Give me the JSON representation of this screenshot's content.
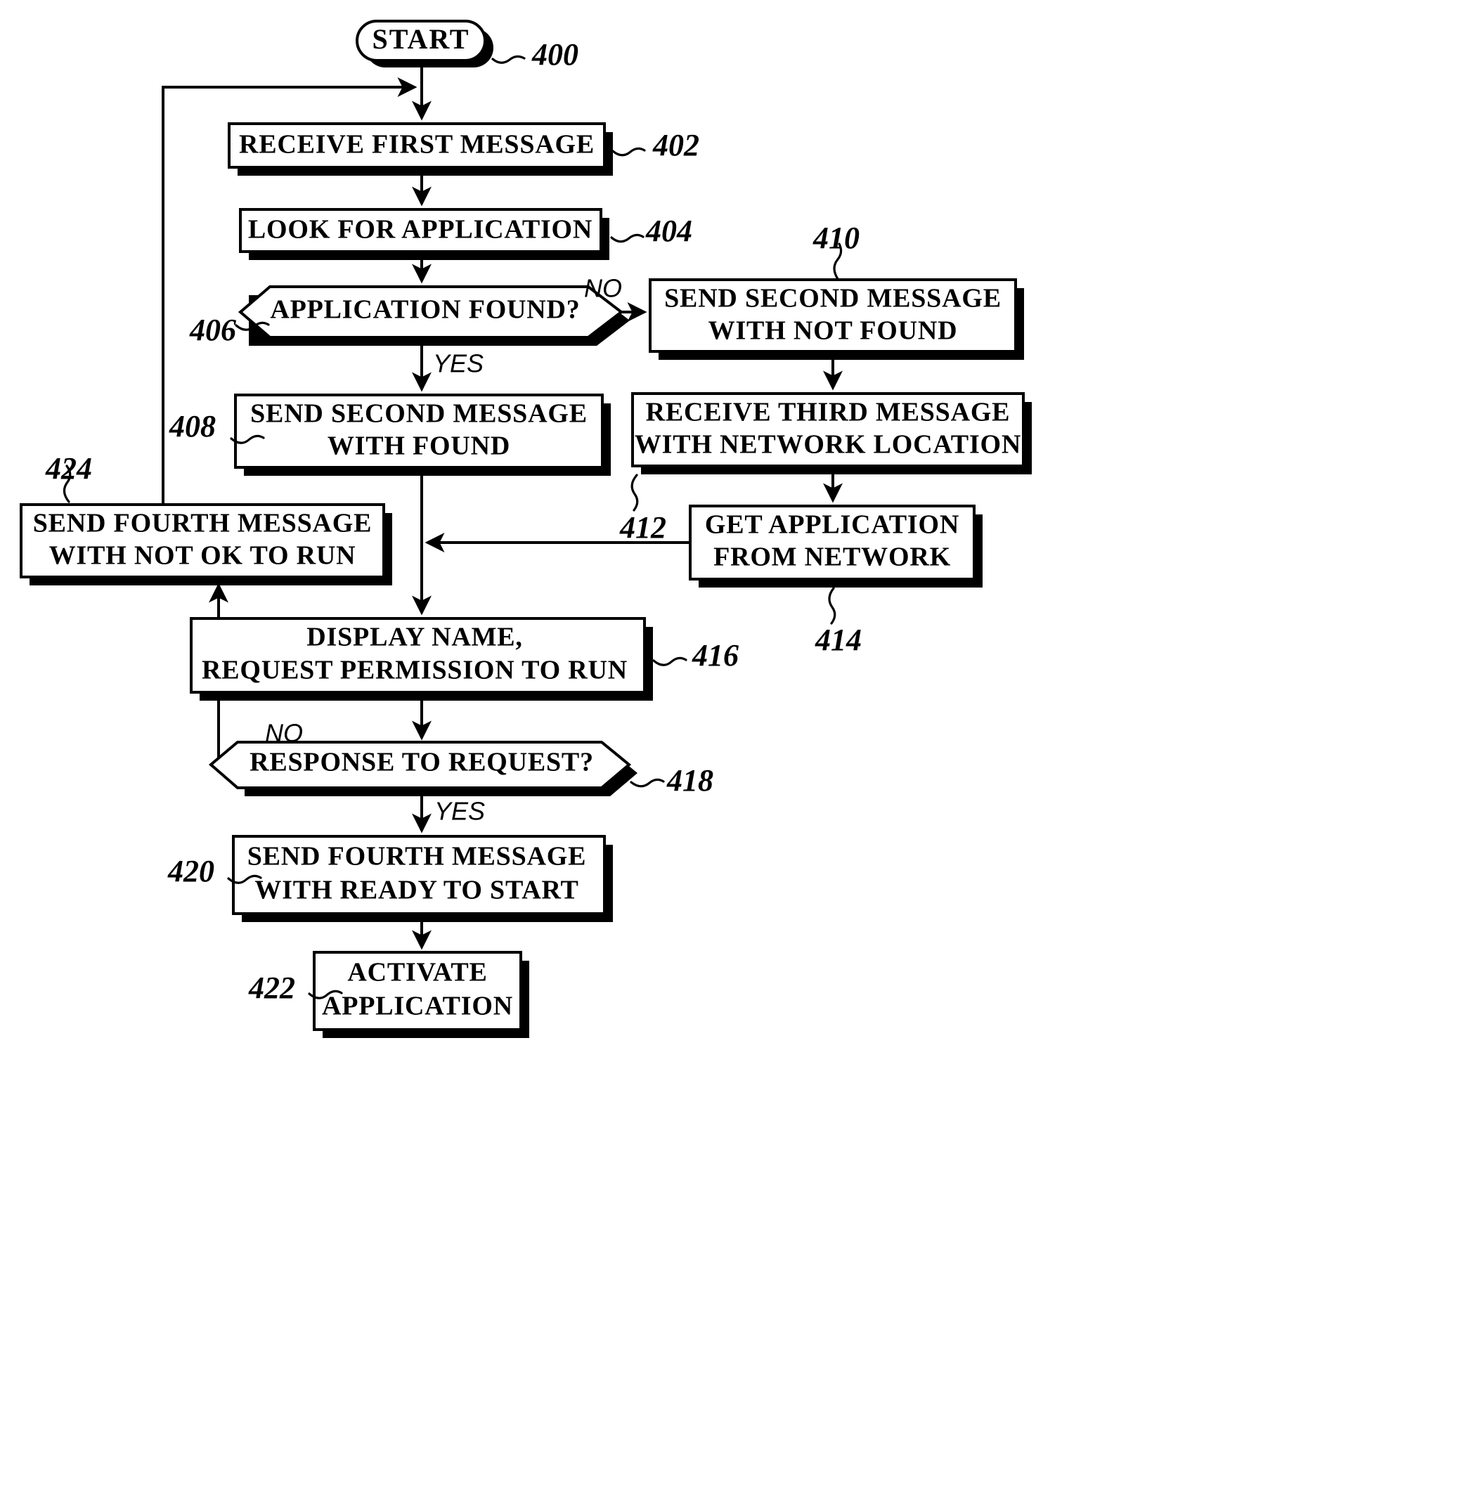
{
  "figure": {
    "type": "flowchart",
    "background": "#ffffff",
    "ink": "#000000"
  },
  "nodes": [
    {
      "id": "start",
      "ref": "400",
      "shape": "terminator",
      "lines": [
        "START"
      ]
    },
    {
      "id": "n402",
      "ref": "402",
      "shape": "process",
      "lines": [
        "RECEIVE FIRST MESSAGE"
      ]
    },
    {
      "id": "n404",
      "ref": "404",
      "shape": "process",
      "lines": [
        "LOOK FOR APPLICATION"
      ]
    },
    {
      "id": "n406",
      "ref": "406",
      "shape": "decision",
      "lines": [
        "APPLICATION FOUND?"
      ]
    },
    {
      "id": "n410",
      "ref": "410",
      "shape": "process",
      "lines": [
        "SEND SECOND MESSAGE",
        "WITH NOT FOUND"
      ]
    },
    {
      "id": "n408",
      "ref": "408",
      "shape": "process",
      "lines": [
        "SEND SECOND MESSAGE",
        "WITH FOUND"
      ]
    },
    {
      "id": "n412",
      "ref": "412",
      "shape": "process",
      "lines": [
        "RECEIVE THIRD MESSAGE",
        "WITH NETWORK LOCATION"
      ]
    },
    {
      "id": "n414",
      "ref": "414",
      "shape": "process",
      "lines": [
        "GET APPLICATION",
        "FROM NETWORK"
      ]
    },
    {
      "id": "n424",
      "ref": "424",
      "shape": "process",
      "lines": [
        "SEND FOURTH MESSAGE",
        "WITH NOT OK TO RUN"
      ]
    },
    {
      "id": "n416",
      "ref": "416",
      "shape": "process",
      "lines": [
        "DISPLAY NAME,",
        "REQUEST PERMISSION TO RUN"
      ]
    },
    {
      "id": "n418",
      "ref": "418",
      "shape": "decision",
      "lines": [
        "RESPONSE TO REQUEST?"
      ]
    },
    {
      "id": "n420",
      "ref": "420",
      "shape": "process",
      "lines": [
        "SEND FOURTH MESSAGE",
        "WITH READY TO START"
      ]
    },
    {
      "id": "n422",
      "ref": "422",
      "shape": "process",
      "lines": [
        "ACTIVATE",
        "APPLICATION"
      ]
    }
  ],
  "branch_labels": [
    {
      "id": "b406no",
      "text": "NO",
      "from": "n406"
    },
    {
      "id": "b406yes",
      "text": "YES",
      "from": "n406"
    },
    {
      "id": "b418no",
      "text": "NO",
      "from": "n418"
    },
    {
      "id": "b418yes",
      "text": "YES",
      "from": "n418"
    }
  ],
  "edges": [
    {
      "from": "start",
      "to": "n402"
    },
    {
      "from": "n402",
      "to": "n404"
    },
    {
      "from": "n404",
      "to": "n406"
    },
    {
      "from": "n406",
      "to": "n410",
      "label": "NO"
    },
    {
      "from": "n406",
      "to": "n408",
      "label": "YES"
    },
    {
      "from": "n410",
      "to": "n412"
    },
    {
      "from": "n412",
      "to": "n414"
    },
    {
      "from": "n414",
      "to": "n416"
    },
    {
      "from": "n408",
      "to": "n416"
    },
    {
      "from": "n416",
      "to": "n418"
    },
    {
      "from": "n418",
      "to": "n424",
      "label": "NO"
    },
    {
      "from": "n418",
      "to": "n420",
      "label": "YES"
    },
    {
      "from": "n420",
      "to": "n422"
    },
    {
      "from": "n424",
      "to": "n402"
    }
  ]
}
